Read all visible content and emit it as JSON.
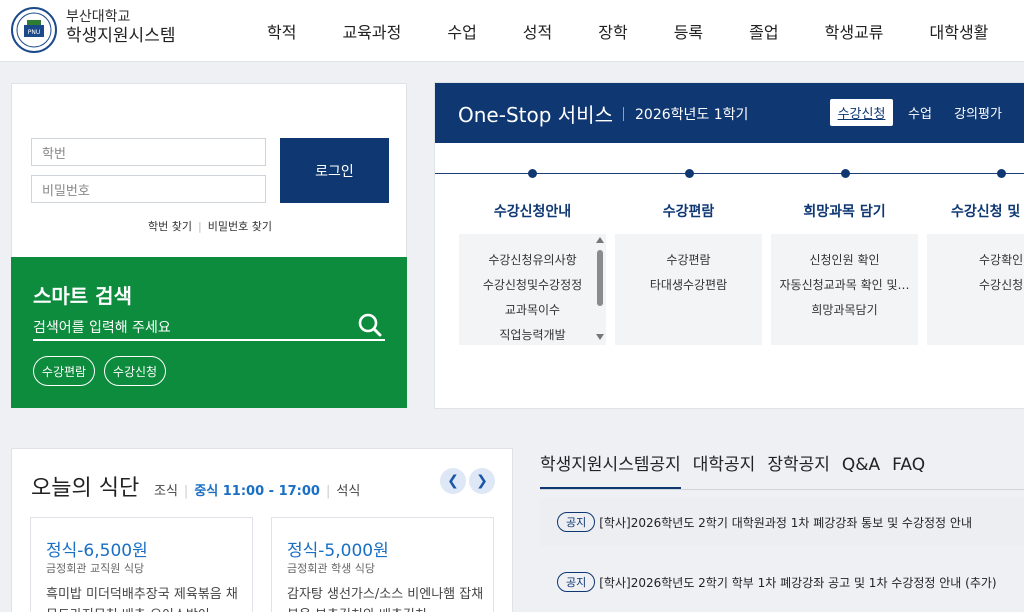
{
  "header": {
    "logo_line1": "부산대학교",
    "logo_line2": "학생지원시스템",
    "nav": [
      "학적",
      "교육과정",
      "수업",
      "성적",
      "장학",
      "등록",
      "졸업",
      "학생교류",
      "대학생활"
    ]
  },
  "login": {
    "id_placeholder": "학번",
    "pw_placeholder": "비밀번호",
    "login_label": "로그인",
    "find_id": "학번 찾기",
    "find_pw": "비밀번호 찾기"
  },
  "smart_search": {
    "title": "스마트 검색",
    "placeholder": "검색어를 입력해 주세요",
    "chips": [
      "수강편람",
      "수강신청"
    ]
  },
  "onestop": {
    "title": "One-Stop 서비스",
    "term": "2026학년도 1학기",
    "tabs": [
      "수강신청",
      "수업",
      "강의평가"
    ],
    "columns": [
      {
        "title": "수강신청안내",
        "items": [
          "수강신청유의사항",
          "수강신청및수강정정",
          "교과목이수",
          "직업능력개발"
        ]
      },
      {
        "title": "수강편람",
        "items": [
          "수강편람",
          "타대생수강편람"
        ]
      },
      {
        "title": "희망과목 담기",
        "items": [
          "신청인원 확인",
          "자동신청교과목 확인 및…",
          "희망과목담기"
        ]
      },
      {
        "title": "수강신청 및",
        "items": [
          "수강확인",
          "수강신청"
        ]
      }
    ]
  },
  "meal": {
    "title": "오늘의 식단",
    "tab_breakfast": "조식",
    "tab_lunch": "중식 11:00 - 17:00",
    "tab_dinner": "석식",
    "cards": [
      {
        "price": "정식-6,500원",
        "where": "금정회관 교직원 식당",
        "menu": "흑미밥 미더덕배추장국 제육볶음 채무도라지무침 배추 오이소박이"
      },
      {
        "price": "정식-5,000원",
        "where": "금정회관 학생 식당",
        "menu": "감자탕 생선가스/소스 비엔나햄 잡채볶음 부추김치와 배추김치"
      }
    ]
  },
  "notices": {
    "tabs": [
      "학생지원시스템공지",
      "대학공지",
      "장학공지",
      "Q&A",
      "FAQ"
    ],
    "items": [
      {
        "badge": "공지",
        "text": "[학사]2026학년도 2학기 대학원과정 1차 폐강강좌 통보 및 수강정정 안내"
      },
      {
        "badge": "공지",
        "text": "[학사]2026학년도 2학기 학부 1차 폐강강좌 공고 및 1차 수강정정 안내 (추가)"
      }
    ]
  }
}
